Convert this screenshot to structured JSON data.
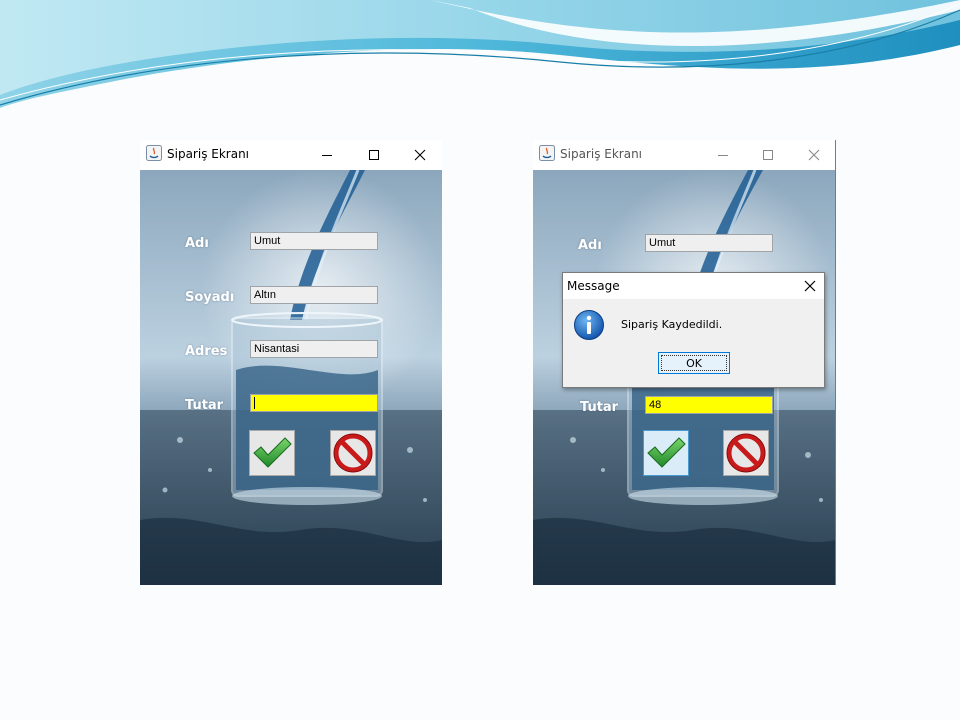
{
  "slide": {
    "accent_colors": [
      "#2aa6cf",
      "#9ed9ea",
      "#1a7fa8"
    ]
  },
  "left_window": {
    "title": "Sipariş Ekranı",
    "labels": {
      "ad": "Adı",
      "soyad": "Soyadı",
      "adres": "Adres",
      "tutar": "Tutar"
    },
    "fields": {
      "ad": "Umut",
      "soyad": "Altın",
      "adres": "Nisantasi",
      "tutar": ""
    },
    "buttons": {
      "confirm_icon": "check-icon",
      "cancel_icon": "no-entry-icon"
    }
  },
  "right_window": {
    "title": "Sipariş Ekranı",
    "labels": {
      "ad": "Adı",
      "tutar": "Tutar"
    },
    "fields": {
      "ad": "Umut",
      "tutar": "48"
    },
    "buttons": {
      "confirm_icon": "check-icon",
      "cancel_icon": "no-entry-icon"
    }
  },
  "dialog": {
    "title": "Message",
    "icon": "info-icon",
    "text": "Sipariş Kaydedildi.",
    "ok_label": "OK"
  },
  "colors": {
    "highlight_field": "#ffff00",
    "window_background": "#6d8aa3"
  }
}
